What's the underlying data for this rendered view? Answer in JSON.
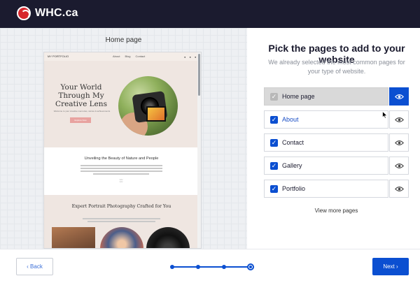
{
  "header": {
    "logo_text": "WHC.ca",
    "logo_icon": "whc-logo-icon"
  },
  "preview": {
    "title": "Home page",
    "site": {
      "brand": "MY PORTFOLIO",
      "menu": [
        "About",
        "Blog",
        "Contact"
      ],
      "hero_title": "Your World Through My Creative Lens",
      "hero_subtitle": "Welcome to your creative memories, stories & achievements",
      "hero_button": "Explore Now",
      "section2_title": "Unveiling the Beauty of Nature and People",
      "section3_title": "Expert Portrait Photography Crafted for You"
    }
  },
  "main": {
    "title": "Pick the pages to add to your website",
    "subtitle": "We already selected the most common pages for your type of website.",
    "pages": [
      {
        "label": "Home page",
        "checked": true,
        "disabled": true,
        "preview_active": true
      },
      {
        "label": "About",
        "checked": true,
        "disabled": false,
        "preview_active": false
      },
      {
        "label": "Contact",
        "checked": true,
        "disabled": false,
        "preview_active": false
      },
      {
        "label": "Gallery",
        "checked": true,
        "disabled": false,
        "preview_active": false
      },
      {
        "label": "Portfolio",
        "checked": true,
        "disabled": false,
        "preview_active": false
      }
    ],
    "view_more": "View more pages"
  },
  "footer": {
    "back_label": "‹ Back",
    "next_label": "Next ›",
    "steps_total": 4,
    "current_step": 4
  },
  "colors": {
    "accent": "#0b4fd1",
    "header_bg": "#1b1b2f",
    "brand_red": "#d7262c"
  }
}
